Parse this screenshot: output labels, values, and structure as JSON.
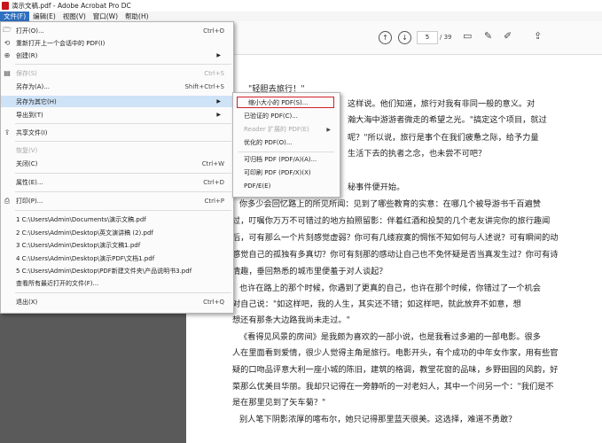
{
  "window": {
    "title": "演示文稿.pdf - Adobe Acrobat Pro DC"
  },
  "menubar": [
    "文件(F)",
    "编辑(E)",
    "视图(V)",
    "窗口(W)",
    "帮助(H)"
  ],
  "toolbar": {
    "page_current": "5",
    "page_total": "/ 39"
  },
  "file_menu": {
    "open": "打开(O)...",
    "open_sc": "Ctrl+O",
    "reopen": "重新打开上一个会话中的 PDF(I)",
    "create": "创建(R)",
    "save": "保存(S)",
    "save_sc": "Ctrl+S",
    "save_as": "另存为(A)...",
    "save_as_sc": "Shift+Ctrl+S",
    "save_as_other": "另存为其它(H)",
    "export": "导出到(T)",
    "share": "共享文件(I)",
    "revert": "恢复(V)",
    "close": "关闭(C)",
    "close_sc": "Ctrl+W",
    "properties": "属性(E)...",
    "properties_sc": "Ctrl+D",
    "print": "打印(P)...",
    "print_sc": "Ctrl+P",
    "recent": [
      "1 C:\\Users\\Admin\\Documents\\演示文稿.pdf",
      "2 C:\\Users\\Admin\\Desktop\\英文演讲稿 (2).pdf",
      "3 C:\\Users\\Admin\\Desktop\\演示文稿1.pdf",
      "4 C:\\Users\\Admin\\Desktop\\演示PDF\\文档1.pdf",
      "5 C:\\Users\\Admin\\Desktop\\PDF新建文件夹\\产品说明书3.pdf"
    ],
    "view_all_recent": "查看所有最近打开的文件(F)...",
    "exit": "退出(X)",
    "exit_sc": "Ctrl+Q"
  },
  "submenu": {
    "reduced": "缩小大小的 PDF(S)...",
    "certified": "已验证的 PDF(C)...",
    "reader_ext": "Reader 扩展的 PDF(E)",
    "optimized": "优化的 PDF(O)...",
    "archivable": "可归档 PDF (PDF/A)(A)...",
    "printable": "可印刷 PDF (PDF/X)(X)",
    "pdfe": "PDF/E(E)"
  },
  "doc": {
    "lines": [
      "\"轻胆去旅行！\"",
      "这样说。他们知道，旅行对我有非同一般的意义。对",
      "瀚大海中游游者微走的希望之光。\"搞定这个项目，就过",
      "呢？\"所以说，旅行是事个在我们疲惫之际，给予力量",
      "生活下去的执者之念，也未尝不可吧？",
      "秘事件便开始。",
      "你多少会回忆路上的所见所闻：见到了哪些教育的实意：在哪几个被导游书千百遍赞",
      "过，叮嘱你万万不可错过的地方拍照留影：伴着红酒和投契的几个老友讲完你的旅行趣闻",
      "后，可有那么一个片刻感觉虚弱？你可有几缕寂寞的惆怅不知如何与人述说？可有瞬间的动",
      "感觉自己的孤独有多真切？你可有刻那的感动让自己也不免怀疑是否当真发生过？你可有诗",
      "情趣，垂回熟悉的城市里便羞于对人谈起？",
      "也许在路上的那个时候，你遇到了更真的自己，也许在那个时候，你错过了一个机会",
      "对自己说：\"如这样吧，我的人生，其实还不错；如这样吧，就此放弃不如意，想",
      "想还有那条大边路我尚未走过。\"",
      "《看得见风景的房间》是我颇为喜欢的一部小说，也是我看过多遍的一部电影。很多",
      "人在里面看到爱情，很少人觉得主角是旅行。电影开头，有个成功的中年女作家，用有些官",
      "疑的口吻品评意大利一座小城的陈旧，建筑的格调，教堂花窗的品味，乡野田园的风韵，好",
      "菜那么优美目华丽。我却只记得在一旁静听的一对老妇人，其中一个问另一个：\"我们是不",
      "是在那里见到了矢车菊？\"",
      "别人笔下阴影浓厚的喀布尔，她只记得那里蓝天很美。这选择，难道不勇敢？"
    ]
  }
}
